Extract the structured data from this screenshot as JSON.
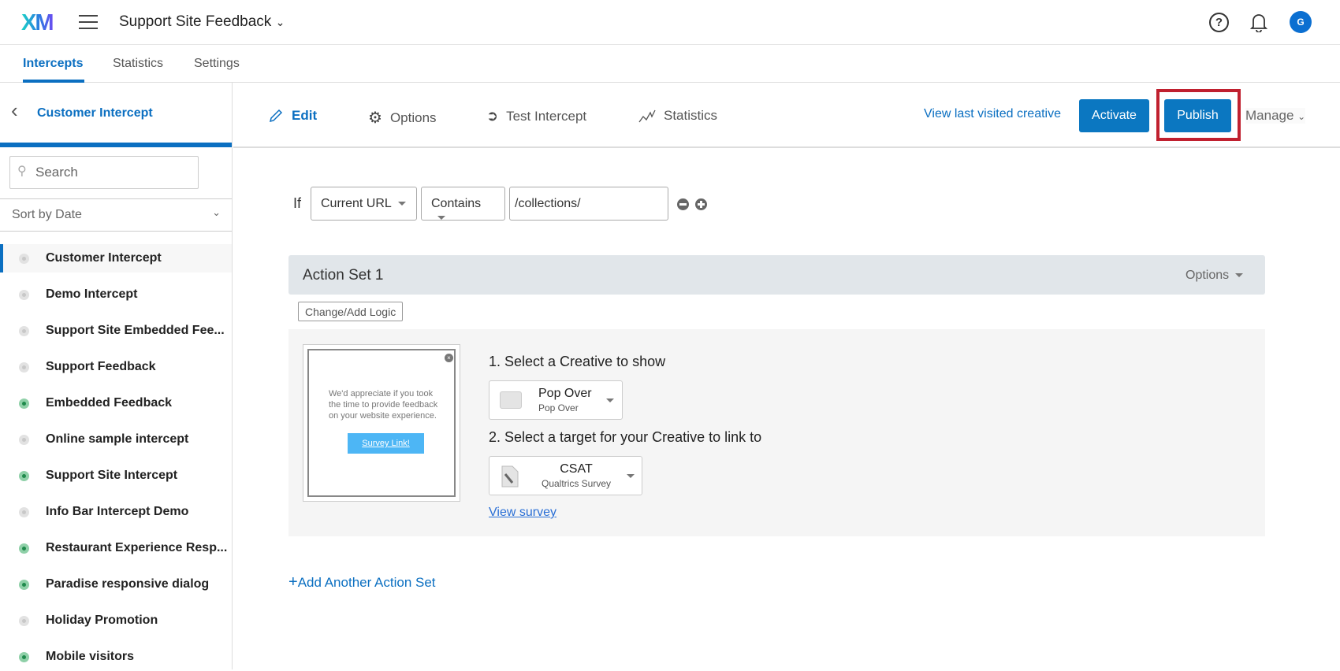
{
  "header": {
    "logo": "XM",
    "project_title": "Support Site Feedback",
    "avatar_initial": "G"
  },
  "tabs": [
    {
      "label": "Intercepts",
      "active": true
    },
    {
      "label": "Statistics"
    },
    {
      "label": "Settings"
    }
  ],
  "sidebar": {
    "back_label": "Customer Intercept",
    "search_placeholder": "Search",
    "sort_label": "Sort by Date",
    "items": [
      {
        "label": "Customer Intercept",
        "active": false,
        "selected": true
      },
      {
        "label": "Demo Intercept",
        "active": false
      },
      {
        "label": "Support Site Embedded Fee...",
        "active": false
      },
      {
        "label": "Support Feedback",
        "active": false
      },
      {
        "label": "Embedded Feedback",
        "active": true
      },
      {
        "label": "Online sample intercept",
        "active": false
      },
      {
        "label": "Support Site Intercept",
        "active": true
      },
      {
        "label": "Info Bar Intercept Demo",
        "active": false
      },
      {
        "label": "Restaurant Experience Resp...",
        "active": true
      },
      {
        "label": "Paradise responsive dialog",
        "active": true
      },
      {
        "label": "Holiday Promotion",
        "active": false
      },
      {
        "label": "Mobile visitors",
        "active": true
      }
    ]
  },
  "toolbar": {
    "edit": "Edit",
    "options": "Options",
    "test": "Test Intercept",
    "statistics": "Statistics",
    "view_last": "View last visited creative",
    "activate": "Activate",
    "publish": "Publish",
    "manage": "Manage"
  },
  "logic": {
    "if": "If",
    "field": "Current URL",
    "operator": "Contains",
    "value": "/collections/"
  },
  "action_set": {
    "title": "Action Set 1",
    "options": "Options",
    "change_logic": "Change/Add Logic",
    "preview": {
      "text": "We'd appreciate if you took the time to provide feedback on your website experience.",
      "link": "Survey Link!"
    },
    "step1": "1. Select a Creative to show",
    "creative_name": "Pop Over",
    "creative_type": "Pop Over",
    "step2": "2. Select a target for your Creative to link to",
    "target_name": "CSAT",
    "target_type": "Qualtrics Survey",
    "view_survey": "View survey"
  },
  "add_action_set": "Add Another Action Set",
  "colors": {
    "accent": "#0b77c1",
    "highlight": "#c0202f"
  }
}
